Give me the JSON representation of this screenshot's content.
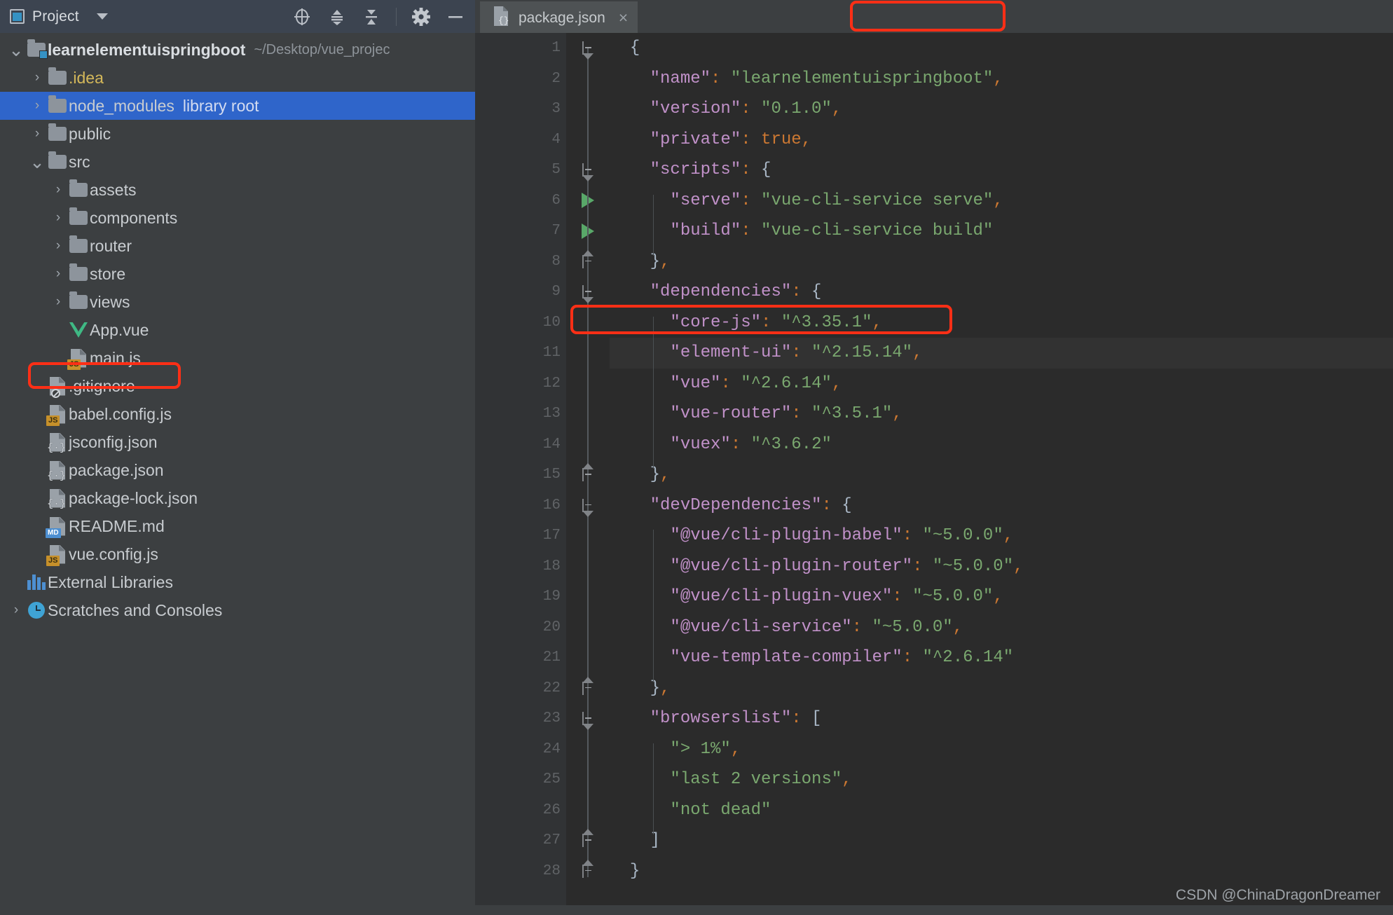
{
  "window": {
    "panel_title": "Project",
    "watermark": "CSDN @ChinaDragonDreamer"
  },
  "toolbar": {
    "locate_icon": "locate-crosshair-icon",
    "expand_icon": "expand-all-icon",
    "collapse_icon": "collapse-all-icon",
    "settings_icon": "gear-icon",
    "hide_icon": "minimize-icon"
  },
  "tabs": [
    {
      "label": "package.json",
      "icon": "json-file-icon",
      "close": "×",
      "active": true,
      "highlighted": true
    }
  ],
  "tree": {
    "items": [
      {
        "label": "learnelementuispringboot",
        "note": "~/Desktop/vue_projec",
        "arrow": "⌄",
        "icon": "project-module-icon",
        "indent": 0,
        "bold": true,
        "selected": false
      },
      {
        "label": ".idea",
        "note": "",
        "arrow": "›",
        "icon": "folder-icon",
        "indent": 1,
        "yellow": true,
        "selected": false
      },
      {
        "label": "node_modules",
        "note": "library root",
        "arrow": "›",
        "icon": "folder-icon",
        "indent": 1,
        "selected": true
      },
      {
        "label": "public",
        "note": "",
        "arrow": "›",
        "icon": "folder-icon",
        "indent": 1,
        "selected": false
      },
      {
        "label": "src",
        "note": "",
        "arrow": "⌄",
        "icon": "folder-icon",
        "indent": 1,
        "selected": false
      },
      {
        "label": "assets",
        "note": "",
        "arrow": "›",
        "icon": "folder-icon",
        "indent": 2,
        "selected": false
      },
      {
        "label": "components",
        "note": "",
        "arrow": "›",
        "icon": "folder-icon",
        "indent": 2,
        "selected": false
      },
      {
        "label": "router",
        "note": "",
        "arrow": "›",
        "icon": "folder-icon",
        "indent": 2,
        "selected": false
      },
      {
        "label": "store",
        "note": "",
        "arrow": "›",
        "icon": "folder-icon",
        "indent": 2,
        "selected": false
      },
      {
        "label": "views",
        "note": "",
        "arrow": "›",
        "icon": "folder-icon",
        "indent": 2,
        "selected": false
      },
      {
        "label": "App.vue",
        "note": "",
        "arrow": "",
        "icon": "vue-file-icon",
        "indent": 2,
        "selected": false
      },
      {
        "label": "main.js",
        "note": "",
        "arrow": "",
        "icon": "js-file-icon",
        "indent": 2,
        "selected": false
      },
      {
        "label": ".gitignore",
        "note": "",
        "arrow": "",
        "icon": "gitignore-file-icon",
        "indent": 1,
        "selected": false
      },
      {
        "label": "babel.config.js",
        "note": "",
        "arrow": "",
        "icon": "js-file-icon",
        "indent": 1,
        "selected": false
      },
      {
        "label": "jsconfig.json",
        "note": "",
        "arrow": "",
        "icon": "json-file-icon",
        "indent": 1,
        "selected": false
      },
      {
        "label": "package.json",
        "note": "",
        "arrow": "",
        "icon": "json-file-icon",
        "indent": 1,
        "selected": false,
        "highlighted": true
      },
      {
        "label": "package-lock.json",
        "note": "",
        "arrow": "",
        "icon": "json-file-icon",
        "indent": 1,
        "selected": false
      },
      {
        "label": "README.md",
        "note": "",
        "arrow": "",
        "icon": "markdown-file-icon",
        "indent": 1,
        "selected": false
      },
      {
        "label": "vue.config.js",
        "note": "",
        "arrow": "",
        "icon": "js-file-icon",
        "indent": 1,
        "selected": false
      },
      {
        "label": "External Libraries",
        "note": "",
        "arrow": "",
        "icon": "libraries-icon",
        "indent": 0,
        "selected": false
      },
      {
        "label": "Scratches and Consoles",
        "note": "",
        "arrow": "›",
        "icon": "scratches-icon",
        "indent": 0,
        "selected": false
      }
    ]
  },
  "editor": {
    "file": "package.json",
    "highlighted_line": 11,
    "run_gutter_lines": [
      6,
      7
    ],
    "fold_lines": [
      1,
      5,
      8,
      9,
      15,
      16,
      22,
      23,
      27,
      28
    ],
    "lines": [
      {
        "n": 1,
        "indent": 0,
        "tokens": [
          [
            "br",
            "{"
          ]
        ]
      },
      {
        "n": 2,
        "indent": 1,
        "tokens": [
          [
            "k",
            "\"name\""
          ],
          [
            "p",
            ":"
          ],
          [
            "s",
            " \"learnelementuispringboot\""
          ],
          [
            "p",
            ","
          ]
        ]
      },
      {
        "n": 3,
        "indent": 1,
        "tokens": [
          [
            "k",
            "\"version\""
          ],
          [
            "p",
            ":"
          ],
          [
            "s",
            " \"0.1.0\""
          ],
          [
            "p",
            ","
          ]
        ]
      },
      {
        "n": 4,
        "indent": 1,
        "tokens": [
          [
            "k",
            "\"private\""
          ],
          [
            "p",
            ":"
          ],
          [
            "v",
            " true"
          ],
          [
            "p",
            ","
          ]
        ]
      },
      {
        "n": 5,
        "indent": 1,
        "tokens": [
          [
            "k",
            "\"scripts\""
          ],
          [
            "p",
            ":"
          ],
          [
            "br",
            " {"
          ]
        ]
      },
      {
        "n": 6,
        "indent": 2,
        "tokens": [
          [
            "k",
            "\"serve\""
          ],
          [
            "p",
            ":"
          ],
          [
            "s",
            " \"vue-cli-service serve\""
          ],
          [
            "p",
            ","
          ]
        ]
      },
      {
        "n": 7,
        "indent": 2,
        "tokens": [
          [
            "k",
            "\"build\""
          ],
          [
            "p",
            ":"
          ],
          [
            "s",
            " \"vue-cli-service build\""
          ]
        ]
      },
      {
        "n": 8,
        "indent": 1,
        "tokens": [
          [
            "br",
            "}"
          ],
          [
            "p",
            ","
          ]
        ]
      },
      {
        "n": 9,
        "indent": 1,
        "tokens": [
          [
            "k",
            "\"dependencies\""
          ],
          [
            "p",
            ":"
          ],
          [
            "br",
            " {"
          ]
        ]
      },
      {
        "n": 10,
        "indent": 2,
        "tokens": [
          [
            "k",
            "\"core-js\""
          ],
          [
            "p",
            ":"
          ],
          [
            "s",
            " \"^3.35.1\""
          ],
          [
            "p",
            ","
          ]
        ]
      },
      {
        "n": 11,
        "indent": 2,
        "tokens": [
          [
            "k",
            "\"element-ui\""
          ],
          [
            "p",
            ":"
          ],
          [
            "s",
            " \"^2.15.14\""
          ],
          [
            "p",
            ","
          ]
        ]
      },
      {
        "n": 12,
        "indent": 2,
        "tokens": [
          [
            "k",
            "\"vue\""
          ],
          [
            "p",
            ":"
          ],
          [
            "s",
            " \"^2.6.14\""
          ],
          [
            "p",
            ","
          ]
        ]
      },
      {
        "n": 13,
        "indent": 2,
        "tokens": [
          [
            "k",
            "\"vue-router\""
          ],
          [
            "p",
            ":"
          ],
          [
            "s",
            " \"^3.5.1\""
          ],
          [
            "p",
            ","
          ]
        ]
      },
      {
        "n": 14,
        "indent": 2,
        "tokens": [
          [
            "k",
            "\"vuex\""
          ],
          [
            "p",
            ":"
          ],
          [
            "s",
            " \"^3.6.2\""
          ]
        ]
      },
      {
        "n": 15,
        "indent": 1,
        "tokens": [
          [
            "br",
            "}"
          ],
          [
            "p",
            ","
          ]
        ]
      },
      {
        "n": 16,
        "indent": 1,
        "tokens": [
          [
            "k",
            "\"devDependencies\""
          ],
          [
            "p",
            ":"
          ],
          [
            "br",
            " {"
          ]
        ]
      },
      {
        "n": 17,
        "indent": 2,
        "tokens": [
          [
            "k",
            "\"@vue/cli-plugin-babel\""
          ],
          [
            "p",
            ":"
          ],
          [
            "s",
            " \"~5.0.0\""
          ],
          [
            "p",
            ","
          ]
        ]
      },
      {
        "n": 18,
        "indent": 2,
        "tokens": [
          [
            "k",
            "\"@vue/cli-plugin-router\""
          ],
          [
            "p",
            ":"
          ],
          [
            "s",
            " \"~5.0.0\""
          ],
          [
            "p",
            ","
          ]
        ]
      },
      {
        "n": 19,
        "indent": 2,
        "tokens": [
          [
            "k",
            "\"@vue/cli-plugin-vuex\""
          ],
          [
            "p",
            ":"
          ],
          [
            "s",
            " \"~5.0.0\""
          ],
          [
            "p",
            ","
          ]
        ]
      },
      {
        "n": 20,
        "indent": 2,
        "tokens": [
          [
            "k",
            "\"@vue/cli-service\""
          ],
          [
            "p",
            ":"
          ],
          [
            "s",
            " \"~5.0.0\""
          ],
          [
            "p",
            ","
          ]
        ]
      },
      {
        "n": 21,
        "indent": 2,
        "tokens": [
          [
            "k",
            "\"vue-template-compiler\""
          ],
          [
            "p",
            ":"
          ],
          [
            "s",
            " \"^2.6.14\""
          ]
        ]
      },
      {
        "n": 22,
        "indent": 1,
        "tokens": [
          [
            "br",
            "}"
          ],
          [
            "p",
            ","
          ]
        ]
      },
      {
        "n": 23,
        "indent": 1,
        "tokens": [
          [
            "k",
            "\"browserslist\""
          ],
          [
            "p",
            ":"
          ],
          [
            "br",
            " ["
          ]
        ]
      },
      {
        "n": 24,
        "indent": 2,
        "tokens": [
          [
            "s",
            "\"> 1%\""
          ],
          [
            "p",
            ","
          ]
        ]
      },
      {
        "n": 25,
        "indent": 2,
        "tokens": [
          [
            "s",
            "\"last 2 versions\""
          ],
          [
            "p",
            ","
          ]
        ]
      },
      {
        "n": 26,
        "indent": 2,
        "tokens": [
          [
            "s",
            "\"not dead\""
          ]
        ]
      },
      {
        "n": 27,
        "indent": 1,
        "tokens": [
          [
            "br",
            "]"
          ]
        ]
      },
      {
        "n": 28,
        "indent": 0,
        "tokens": [
          [
            "br",
            "}"
          ]
        ]
      }
    ]
  },
  "colors": {
    "selection_blue": "#2f65ca",
    "annotation_red": "#ff2f16",
    "editor_bg": "#2b2b2b",
    "panel_bg": "#3c3f41",
    "string_green": "#7aa86f",
    "key_purple": "#c191c9",
    "punct_orange": "#cc7832",
    "run_green": "#59a869"
  }
}
